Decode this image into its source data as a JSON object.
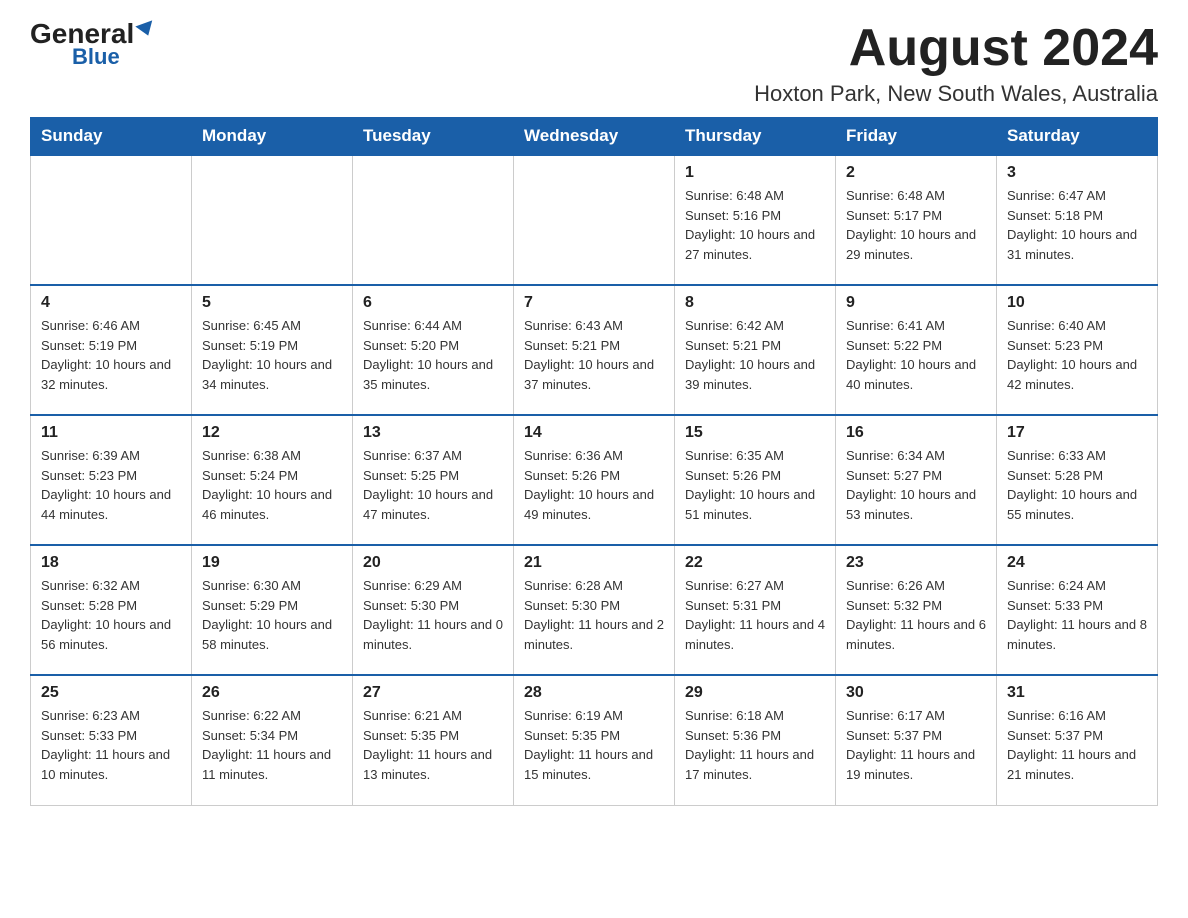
{
  "header": {
    "logo_general": "General",
    "logo_blue": "Blue",
    "month_title": "August 2024",
    "location": "Hoxton Park, New South Wales, Australia"
  },
  "days_of_week": [
    "Sunday",
    "Monday",
    "Tuesday",
    "Wednesday",
    "Thursday",
    "Friday",
    "Saturday"
  ],
  "weeks": [
    [
      {
        "day": "",
        "info": ""
      },
      {
        "day": "",
        "info": ""
      },
      {
        "day": "",
        "info": ""
      },
      {
        "day": "",
        "info": ""
      },
      {
        "day": "1",
        "info": "Sunrise: 6:48 AM\nSunset: 5:16 PM\nDaylight: 10 hours and 27 minutes."
      },
      {
        "day": "2",
        "info": "Sunrise: 6:48 AM\nSunset: 5:17 PM\nDaylight: 10 hours and 29 minutes."
      },
      {
        "day": "3",
        "info": "Sunrise: 6:47 AM\nSunset: 5:18 PM\nDaylight: 10 hours and 31 minutes."
      }
    ],
    [
      {
        "day": "4",
        "info": "Sunrise: 6:46 AM\nSunset: 5:19 PM\nDaylight: 10 hours and 32 minutes."
      },
      {
        "day": "5",
        "info": "Sunrise: 6:45 AM\nSunset: 5:19 PM\nDaylight: 10 hours and 34 minutes."
      },
      {
        "day": "6",
        "info": "Sunrise: 6:44 AM\nSunset: 5:20 PM\nDaylight: 10 hours and 35 minutes."
      },
      {
        "day": "7",
        "info": "Sunrise: 6:43 AM\nSunset: 5:21 PM\nDaylight: 10 hours and 37 minutes."
      },
      {
        "day": "8",
        "info": "Sunrise: 6:42 AM\nSunset: 5:21 PM\nDaylight: 10 hours and 39 minutes."
      },
      {
        "day": "9",
        "info": "Sunrise: 6:41 AM\nSunset: 5:22 PM\nDaylight: 10 hours and 40 minutes."
      },
      {
        "day": "10",
        "info": "Sunrise: 6:40 AM\nSunset: 5:23 PM\nDaylight: 10 hours and 42 minutes."
      }
    ],
    [
      {
        "day": "11",
        "info": "Sunrise: 6:39 AM\nSunset: 5:23 PM\nDaylight: 10 hours and 44 minutes."
      },
      {
        "day": "12",
        "info": "Sunrise: 6:38 AM\nSunset: 5:24 PM\nDaylight: 10 hours and 46 minutes."
      },
      {
        "day": "13",
        "info": "Sunrise: 6:37 AM\nSunset: 5:25 PM\nDaylight: 10 hours and 47 minutes."
      },
      {
        "day": "14",
        "info": "Sunrise: 6:36 AM\nSunset: 5:26 PM\nDaylight: 10 hours and 49 minutes."
      },
      {
        "day": "15",
        "info": "Sunrise: 6:35 AM\nSunset: 5:26 PM\nDaylight: 10 hours and 51 minutes."
      },
      {
        "day": "16",
        "info": "Sunrise: 6:34 AM\nSunset: 5:27 PM\nDaylight: 10 hours and 53 minutes."
      },
      {
        "day": "17",
        "info": "Sunrise: 6:33 AM\nSunset: 5:28 PM\nDaylight: 10 hours and 55 minutes."
      }
    ],
    [
      {
        "day": "18",
        "info": "Sunrise: 6:32 AM\nSunset: 5:28 PM\nDaylight: 10 hours and 56 minutes."
      },
      {
        "day": "19",
        "info": "Sunrise: 6:30 AM\nSunset: 5:29 PM\nDaylight: 10 hours and 58 minutes."
      },
      {
        "day": "20",
        "info": "Sunrise: 6:29 AM\nSunset: 5:30 PM\nDaylight: 11 hours and 0 minutes."
      },
      {
        "day": "21",
        "info": "Sunrise: 6:28 AM\nSunset: 5:30 PM\nDaylight: 11 hours and 2 minutes."
      },
      {
        "day": "22",
        "info": "Sunrise: 6:27 AM\nSunset: 5:31 PM\nDaylight: 11 hours and 4 minutes."
      },
      {
        "day": "23",
        "info": "Sunrise: 6:26 AM\nSunset: 5:32 PM\nDaylight: 11 hours and 6 minutes."
      },
      {
        "day": "24",
        "info": "Sunrise: 6:24 AM\nSunset: 5:33 PM\nDaylight: 11 hours and 8 minutes."
      }
    ],
    [
      {
        "day": "25",
        "info": "Sunrise: 6:23 AM\nSunset: 5:33 PM\nDaylight: 11 hours and 10 minutes."
      },
      {
        "day": "26",
        "info": "Sunrise: 6:22 AM\nSunset: 5:34 PM\nDaylight: 11 hours and 11 minutes."
      },
      {
        "day": "27",
        "info": "Sunrise: 6:21 AM\nSunset: 5:35 PM\nDaylight: 11 hours and 13 minutes."
      },
      {
        "day": "28",
        "info": "Sunrise: 6:19 AM\nSunset: 5:35 PM\nDaylight: 11 hours and 15 minutes."
      },
      {
        "day": "29",
        "info": "Sunrise: 6:18 AM\nSunset: 5:36 PM\nDaylight: 11 hours and 17 minutes."
      },
      {
        "day": "30",
        "info": "Sunrise: 6:17 AM\nSunset: 5:37 PM\nDaylight: 11 hours and 19 minutes."
      },
      {
        "day": "31",
        "info": "Sunrise: 6:16 AM\nSunset: 5:37 PM\nDaylight: 11 hours and 21 minutes."
      }
    ]
  ]
}
